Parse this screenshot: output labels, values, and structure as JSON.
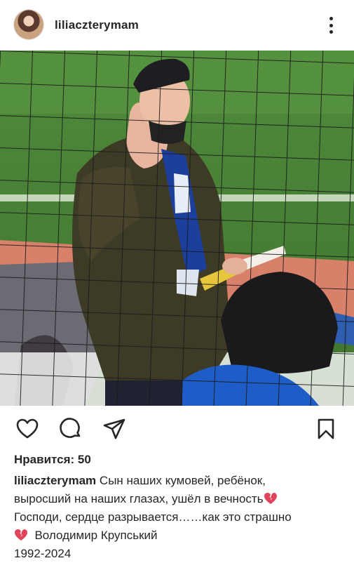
{
  "post": {
    "username": "liliaczterymam",
    "likes_text": "Нравится: 50",
    "caption_username": "liliaczterymam",
    "caption_lines": [
      "Сын наших кумовей, ребёнок,",
      "выросший на наших глазах, ушёл в вечность",
      "Господи, сердце разрывается……как это страшно",
      "Володимир Крупський",
      "1992-2024"
    ]
  },
  "icons": {
    "header_more": "more-vertical-icon",
    "like": "heart-icon",
    "comment": "comment-bubble-icon",
    "share": "send-paper-plane-icon",
    "save": "bookmark-icon",
    "emoji": "broken-heart-icon"
  },
  "colors": {
    "text": "#262626",
    "broken_heart": "#e0445a"
  }
}
